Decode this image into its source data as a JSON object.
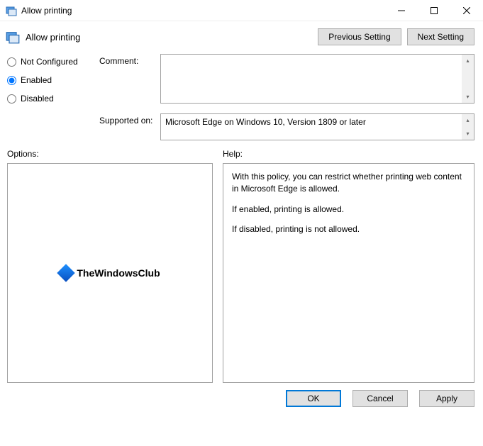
{
  "window": {
    "title": "Allow printing"
  },
  "header": {
    "title": "Allow printing",
    "previous_setting": "Previous Setting",
    "next_setting": "Next Setting"
  },
  "radios": {
    "not_configured": "Not Configured",
    "enabled": "Enabled",
    "disabled": "Disabled",
    "selected": "enabled"
  },
  "fields": {
    "comment_label": "Comment:",
    "comment_value": "",
    "supported_label": "Supported on:",
    "supported_value": "Microsoft Edge on Windows 10, Version 1809 or later"
  },
  "panels": {
    "options_label": "Options:",
    "help_label": "Help:",
    "watermark": "TheWindowsClub",
    "help_p1": "With this policy, you can restrict whether printing web content in Microsoft Edge is allowed.",
    "help_p2": "If enabled, printing is allowed.",
    "help_p3": "If disabled, printing is not allowed."
  },
  "footer": {
    "ok": "OK",
    "cancel": "Cancel",
    "apply": "Apply"
  }
}
